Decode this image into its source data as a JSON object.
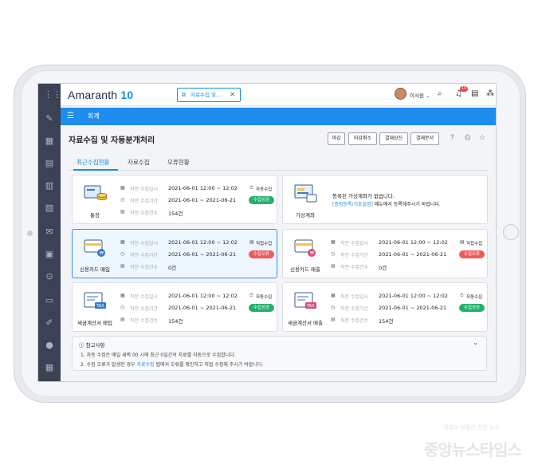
{
  "app": {
    "logo_text": "Amaranth",
    "logo_version": "10",
    "open_tab": "자료수집 및...",
    "user_name": "이사원",
    "notification_count": "10"
  },
  "module": {
    "label": "회계"
  },
  "page": {
    "title": "자료수집 및 자동분개처리",
    "buttons": [
      "마감",
      "마감취소",
      "결재상신",
      "결재문서"
    ],
    "tabs": [
      "최근수집현황",
      "자료수집",
      "오류현황"
    ],
    "active_tab": 0
  },
  "row_labels": [
    "직전 수집일시",
    "직전 수집기간",
    "직전 수집건수"
  ],
  "cards": [
    {
      "name": "통장",
      "datetime": "2021-06-01  12:00 ~ 12:02",
      "period": "2021-06-01 ~ 2021-06-21",
      "count": "154건",
      "mode": "자동수집",
      "status": "수집성공",
      "status_type": "ok",
      "icon": "passbook-icon"
    },
    {
      "name": "가상계좌",
      "empty_message": "등록된 가상계좌가 없습니다.",
      "empty_link": "[증빙등록/기초설정]",
      "empty_suffix": " 메뉴에서 등록해주시기 바랍니다.",
      "icon": "virtual-account-icon"
    },
    {
      "name": "신용카드 매입",
      "datetime": "2021-06-01  12:00 ~ 12:02",
      "period": "2021-06-01 ~ 2021-06-21",
      "count": "0건",
      "mode": "직접수집",
      "status": "수집오류",
      "status_type": "err",
      "icon": "credit-card-purchase-icon"
    },
    {
      "name": "신용카드 매출",
      "datetime": "2021-06-01  12:00 ~ 12:02",
      "period": "2021-06-01 ~ 2021-06-21",
      "count": "0건",
      "mode": "직접수집",
      "status": "수집오류",
      "status_type": "err",
      "icon": "credit-card-sales-icon"
    },
    {
      "name": "세금계산서 매입",
      "datetime": "2021-06-01  12:00 ~ 12:02",
      "period": "2021-06-01 ~ 2021-06-21",
      "count": "154건",
      "mode": "자동수집",
      "status": "수집성공",
      "status_type": "ok",
      "icon": "tax-invoice-purchase-icon"
    },
    {
      "name": "세금계산서 매출",
      "datetime": "2021-06-01  12:00 ~ 12:02",
      "period": "2021-06-01 ~ 2021-06-21",
      "count": "154건",
      "mode": "자동수집",
      "status": "수집성공",
      "status_type": "ok",
      "icon": "tax-invoice-sales-icon"
    }
  ],
  "notes": {
    "title": "참고사항",
    "line1": "1. 자동 수집은 매일 새벽 00 시에 최근 0일간의 자료를 자동으로 수집합니다.",
    "line2_a": "2. 수집 오류가 발생한 경우 ",
    "line2_link": "자료수집",
    "line2_b": " 탭에서 오류를 확인하고 직접 수집해 주시기 바랍니다."
  },
  "watermark": {
    "small": "재테크·부동산 전문 뉴스",
    "main": "중앙뉴스타임스"
  },
  "colors": {
    "accent": "#1f8cf0",
    "success": "#20b26b",
    "error": "#ee5a5a",
    "sidebar": "#3b4254"
  }
}
